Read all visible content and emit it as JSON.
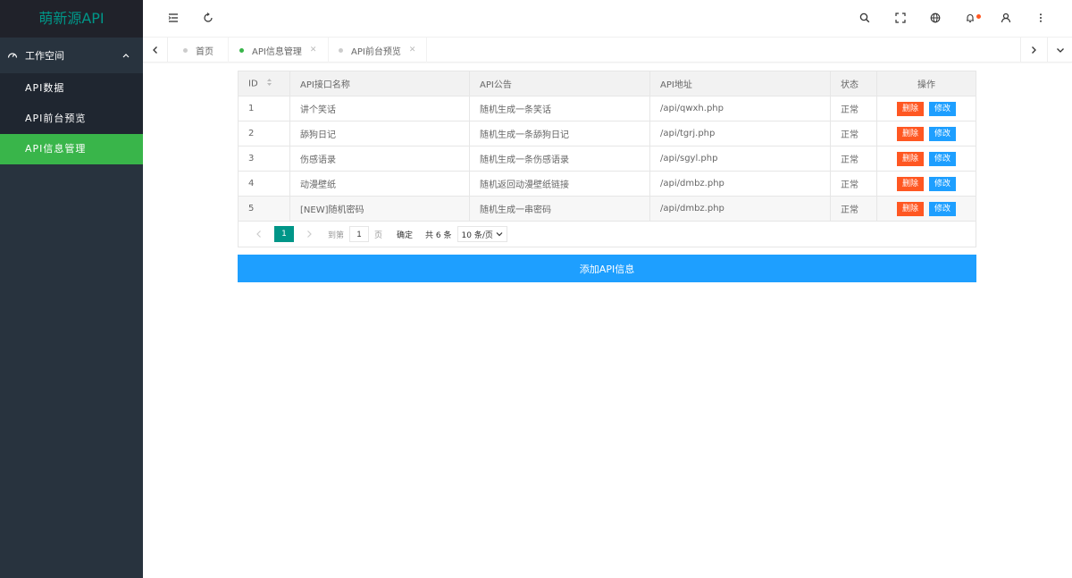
{
  "sidebar": {
    "logo": "萌新源API",
    "group": {
      "label": "工作空间",
      "icon": "dashboard-icon"
    },
    "items": [
      {
        "label": "API数据",
        "active": false
      },
      {
        "label": "API前台预览",
        "active": false
      },
      {
        "label": "API信息管理",
        "active": true
      }
    ]
  },
  "header": {
    "left_icons": [
      "menu-fold-icon",
      "refresh-icon"
    ],
    "right_icons": [
      "search-icon",
      "fullscreen-icon",
      "globe-icon",
      "bell-icon",
      "user-icon",
      "more-icon"
    ]
  },
  "tabs": [
    {
      "label": "首页",
      "active": false,
      "closable": false
    },
    {
      "label": "API信息管理",
      "active": true,
      "closable": true
    },
    {
      "label": "API前台预览",
      "active": false,
      "closable": true
    }
  ],
  "table": {
    "columns": [
      "ID",
      "API接口名称",
      "API公告",
      "API地址",
      "状态",
      "操作"
    ],
    "rows": [
      {
        "id": "1",
        "name": "讲个笑话",
        "notice": "随机生成一条笑话",
        "url": "/api/qwxh.php",
        "status": "正常"
      },
      {
        "id": "2",
        "name": "舔狗日记",
        "notice": "随机生成一条舔狗日记",
        "url": "/api/tgrj.php",
        "status": "正常"
      },
      {
        "id": "3",
        "name": "伤感语录",
        "notice": "随机生成一条伤感语录",
        "url": "/api/sgyl.php",
        "status": "正常"
      },
      {
        "id": "4",
        "name": "动漫壁纸",
        "notice": "随机返回动漫壁纸链接",
        "url": "/api/dmbz.php",
        "status": "正常"
      },
      {
        "id": "5",
        "name": "[NEW]随机密码",
        "notice": "随机生成一串密码",
        "url": "/api/dmbz.php",
        "status": "正常"
      }
    ],
    "delete_label": "删除",
    "edit_label": "修改"
  },
  "pager": {
    "current": "1",
    "goto_prefix": "到第",
    "goto_value": "1",
    "goto_suffix": "页",
    "confirm": "确定",
    "total": "共 6 条",
    "page_size": "10 条/页"
  },
  "add_button": "添加API信息",
  "colors": {
    "primary": "#009688",
    "active_green": "#39b54a",
    "blue": "#1e9fff",
    "danger": "#ff5722",
    "sidebar_bg": "#28333e"
  }
}
